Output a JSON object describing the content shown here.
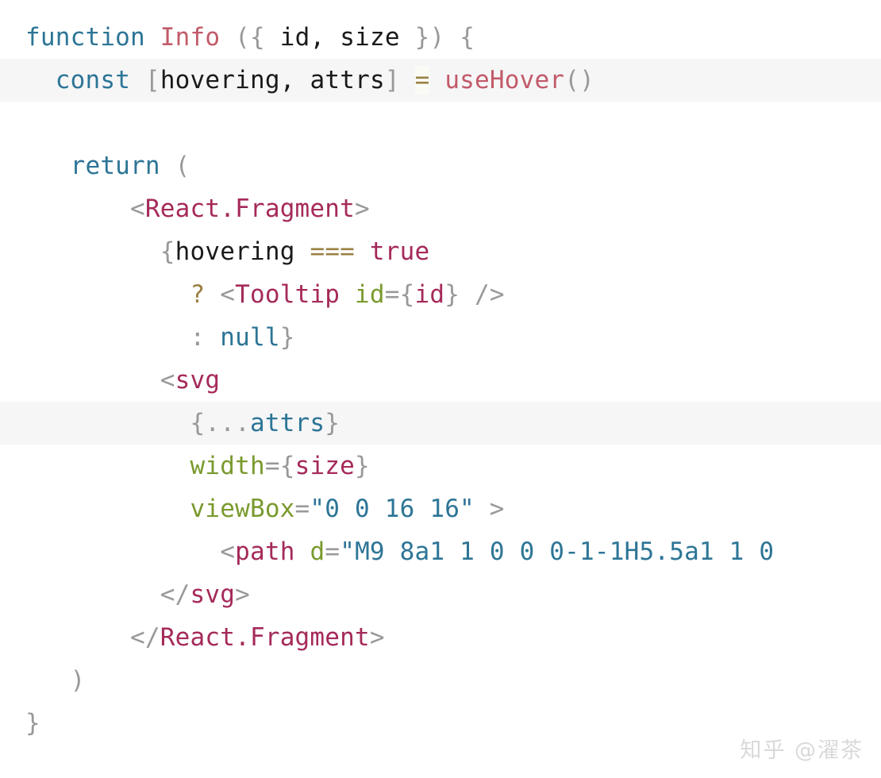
{
  "editor": {
    "language": "jsx",
    "background": "#ffffff",
    "highlight_background": "#f6f6f7",
    "palette": {
      "keyword": "#2d7596",
      "function_name": "#c25b6a",
      "punctuation": "#999999",
      "identifier": "#1a1a1a",
      "operator": "#9a8044",
      "tag": "#a52a5a",
      "attribute": "#7a9a2e",
      "string": "#2d7596",
      "value": "#a52a5a"
    },
    "lines": [
      {
        "n": 1,
        "highlight": false,
        "indent": 0,
        "text": "function Info ({ id, size }) {"
      },
      {
        "n": 2,
        "highlight": true,
        "indent": 1,
        "text": "const [hovering, attrs] = useHover()"
      },
      {
        "n": 3,
        "highlight": false,
        "indent": 0,
        "text": ""
      },
      {
        "n": 4,
        "highlight": false,
        "indent": 1,
        "text": "return ("
      },
      {
        "n": 5,
        "highlight": false,
        "indent": 3,
        "text": "<React.Fragment>"
      },
      {
        "n": 6,
        "highlight": false,
        "indent": 4,
        "text": "{hovering === true"
      },
      {
        "n": 7,
        "highlight": false,
        "indent": 5,
        "text": "? <Tooltip id={id} />"
      },
      {
        "n": 8,
        "highlight": false,
        "indent": 5,
        "text": ": null}"
      },
      {
        "n": 9,
        "highlight": false,
        "indent": 4,
        "text": "<svg"
      },
      {
        "n": 10,
        "highlight": true,
        "indent": 5,
        "text": "{...attrs}"
      },
      {
        "n": 11,
        "highlight": false,
        "indent": 5,
        "text": "width={size}"
      },
      {
        "n": 12,
        "highlight": false,
        "indent": 5,
        "text": "viewBox=\"0 0 16 16\" >"
      },
      {
        "n": 13,
        "highlight": false,
        "indent": 6,
        "text": "<path d=\"M9 8a1 1 0 0 0-1-1H5.5a1 1 0"
      },
      {
        "n": 14,
        "highlight": false,
        "indent": 4,
        "text": "</svg>"
      },
      {
        "n": 15,
        "highlight": false,
        "indent": 3,
        "text": "</React.Fragment>"
      },
      {
        "n": 16,
        "highlight": false,
        "indent": 1,
        "text": ")"
      },
      {
        "n": 17,
        "highlight": false,
        "indent": 0,
        "text": "}"
      }
    ],
    "tokens": {
      "l1": {
        "kw": "function",
        "name": "Info",
        "open_paren": "(",
        "open_brace": "{",
        "p1": "id",
        "comma": ",",
        "p2": "size",
        "close_brace": "}",
        "close_paren": ")",
        "body_brace": "{"
      },
      "l2": {
        "kw": "const",
        "lb": "[",
        "v1": "hovering",
        "comma": ",",
        "v2": "attrs",
        "rb": "]",
        "eq": "=",
        "call": "useHover",
        "parens": "()"
      },
      "l4": {
        "kw": "return",
        "paren": "("
      },
      "l5": {
        "lt": "<",
        "tag": "React.Fragment",
        "gt": ">"
      },
      "l6": {
        "brace": "{",
        "ident": "hovering",
        "op": "===",
        "value": "true"
      },
      "l7": {
        "q": "?",
        "lt": "<",
        "tag": "Tooltip",
        "attr": "id",
        "eq": "=",
        "lb": "{",
        "val": "id",
        "rb": "}",
        "selfclose": "/>"
      },
      "l8": {
        "colon": ":",
        "kw": "null",
        "rb": "}"
      },
      "l9": {
        "lt": "<",
        "tag": "svg"
      },
      "l10": {
        "lb": "{",
        "dots": "...",
        "var": "attrs",
        "rb": "}"
      },
      "l11": {
        "attr": "width",
        "eq": "=",
        "lb": "{",
        "val": "size",
        "rb": "}"
      },
      "l12": {
        "attr": "viewBox",
        "eq": "=",
        "str": "\"0 0 16 16\"",
        "gt": ">"
      },
      "l13": {
        "lt": "<",
        "tag": "path",
        "attr": "d",
        "eq": "=",
        "str": "\"M9 8a1 1 0 0 0-1-1H5.5a1 1 0"
      },
      "l14": {
        "close": "</",
        "tag": "svg",
        "gt": ">"
      },
      "l15": {
        "close": "</",
        "tag": "React.Fragment",
        "gt": ">"
      },
      "l16": {
        "paren": ")"
      },
      "l17": {
        "brace": "}"
      }
    }
  },
  "watermark": {
    "text": "知乎 @濯茶"
  }
}
